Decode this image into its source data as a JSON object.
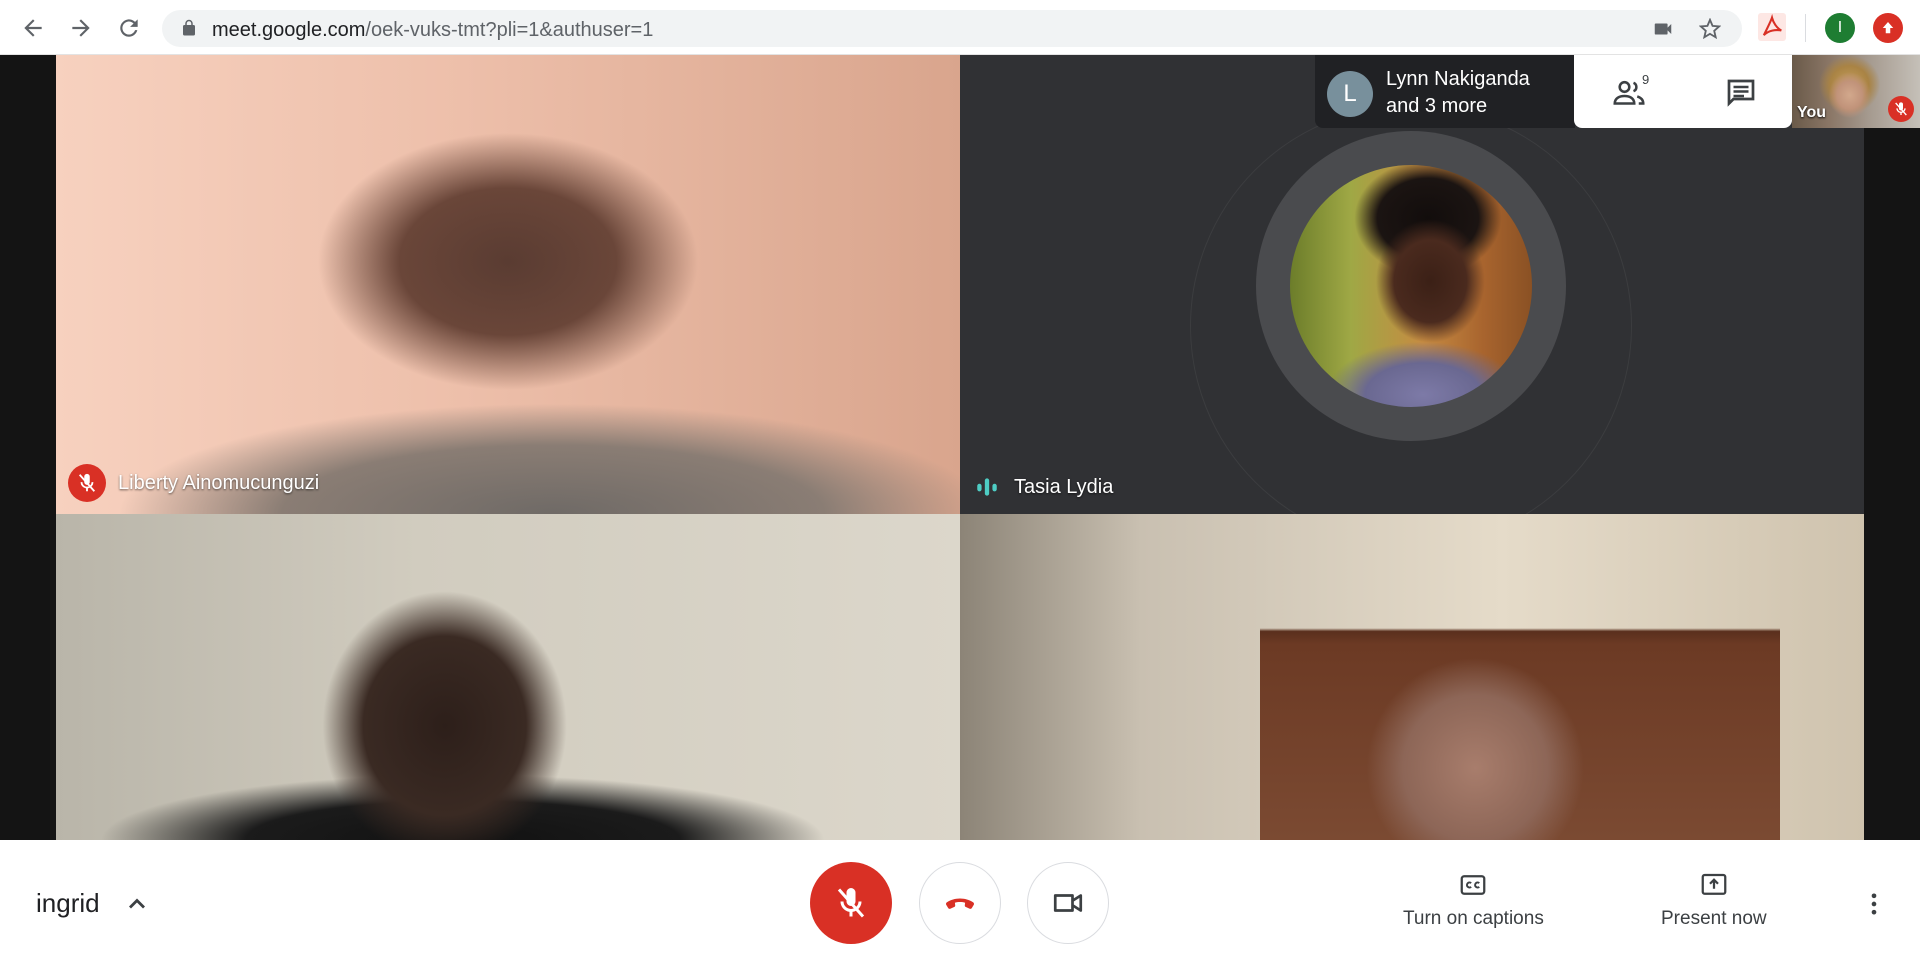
{
  "browser": {
    "url_host": "meet.google.com",
    "url_path": "/oek-vuks-tmt?pli=1&authuser=1",
    "profile_initial": "I"
  },
  "tiles": [
    {
      "name": "Liberty Ainomucunguzi",
      "muted": true
    },
    {
      "name": "Tasia Lydia",
      "speaking": true
    },
    {
      "name": ""
    },
    {
      "name": ""
    }
  ],
  "overlay": {
    "avatar_letter": "L",
    "participant_summary_line1": "Lynn Nakiganda",
    "participant_summary_line2": "and 3 more",
    "people_count": "9",
    "self_label": "You"
  },
  "bottom_bar": {
    "meeting_name": "ingrid",
    "captions_label": "Turn on captions",
    "present_label": "Present now"
  },
  "colors": {
    "accent_red": "#d93025",
    "speaking_teal": "#4ecdc4",
    "profile_green": "#1e7d32"
  }
}
